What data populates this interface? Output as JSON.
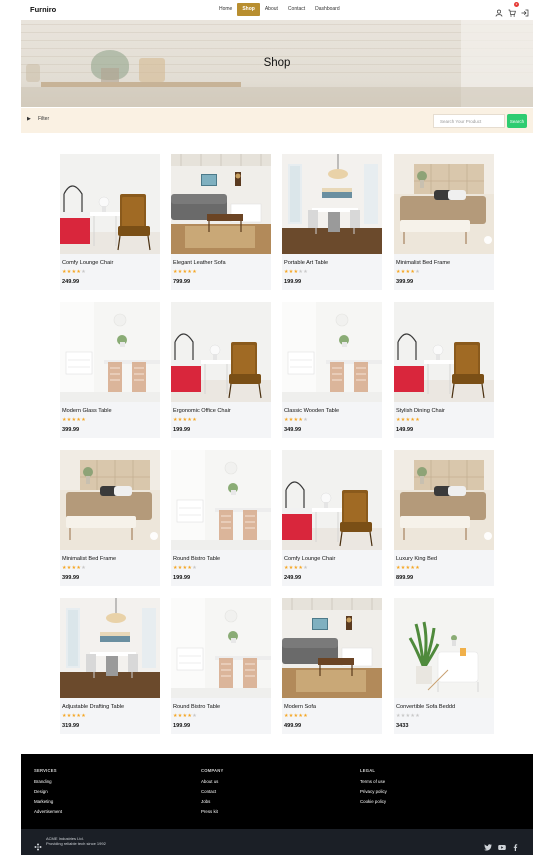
{
  "nav": {
    "brand": "Furniro",
    "links": [
      "Home",
      "Shop",
      "About",
      "Contact",
      "Dashboard"
    ],
    "active": "Shop",
    "cart_count": "2",
    "accent": "#b88e2f"
  },
  "hero": {
    "title": "Shop"
  },
  "filter": {
    "label": "Filter",
    "search_placeholder": "Search Your Product",
    "search_button": "Search"
  },
  "products": [
    {
      "name": "Comfy Lounge Chair",
      "rating": 4,
      "price": "249.99",
      "scene": "chair"
    },
    {
      "name": "Elegant Leather Sofa",
      "rating": 5,
      "price": "799.99",
      "scene": "living"
    },
    {
      "name": "Portable Art Table",
      "rating": 3,
      "price": "199.99",
      "scene": "dining"
    },
    {
      "name": "Minimalist Bed Frame",
      "rating": 4,
      "price": "399.99",
      "scene": "bed"
    },
    {
      "name": "Modern Glass Table",
      "rating": 5,
      "price": "399.99",
      "scene": "white"
    },
    {
      "name": "Ergonomic Office Chair",
      "rating": 5,
      "price": "199.99",
      "scene": "chair"
    },
    {
      "name": "Classic Wooden Table",
      "rating": 4,
      "price": "349.99",
      "scene": "white"
    },
    {
      "name": "Stylish Dining Chair",
      "rating": 5,
      "price": "149.99",
      "scene": "chair"
    },
    {
      "name": "Minimalist Bed Frame",
      "rating": 4,
      "price": "399.99",
      "scene": "bed"
    },
    {
      "name": "Round Bistro Table",
      "rating": 4,
      "price": "199.99",
      "scene": "white"
    },
    {
      "name": "Comfy Lounge Chair",
      "rating": 4,
      "price": "249.99",
      "scene": "chair"
    },
    {
      "name": "Luxury King Bed",
      "rating": 5,
      "price": "899.99",
      "scene": "bed"
    },
    {
      "name": "Adjustable Drafting Table",
      "rating": 5,
      "price": "319.99",
      "scene": "dining"
    },
    {
      "name": "Round Bistro Table",
      "rating": 4,
      "price": "199.99",
      "scene": "white"
    },
    {
      "name": "Modern Sofa",
      "rating": 5,
      "price": "499.99",
      "scene": "living"
    },
    {
      "name": "Convertible Sofa Beddd",
      "rating": 0,
      "price": "3433",
      "scene": "plant"
    }
  ],
  "footer": {
    "columns": [
      {
        "heading": "SERVICES",
        "items": [
          "Branding",
          "Design",
          "Marketing",
          "Advertisement"
        ]
      },
      {
        "heading": "COMPANY",
        "items": [
          "About us",
          "Contact",
          "Jobs",
          "Press kit"
        ]
      },
      {
        "heading": "LEGAL",
        "items": [
          "Terms of use",
          "Privacy policy",
          "Cookie policy"
        ]
      }
    ],
    "company_line1": "ACME Industries Ltd.",
    "company_line2": "Providing reliable tech since 1992",
    "socials": [
      "twitter-icon",
      "youtube-icon",
      "facebook-icon"
    ]
  }
}
